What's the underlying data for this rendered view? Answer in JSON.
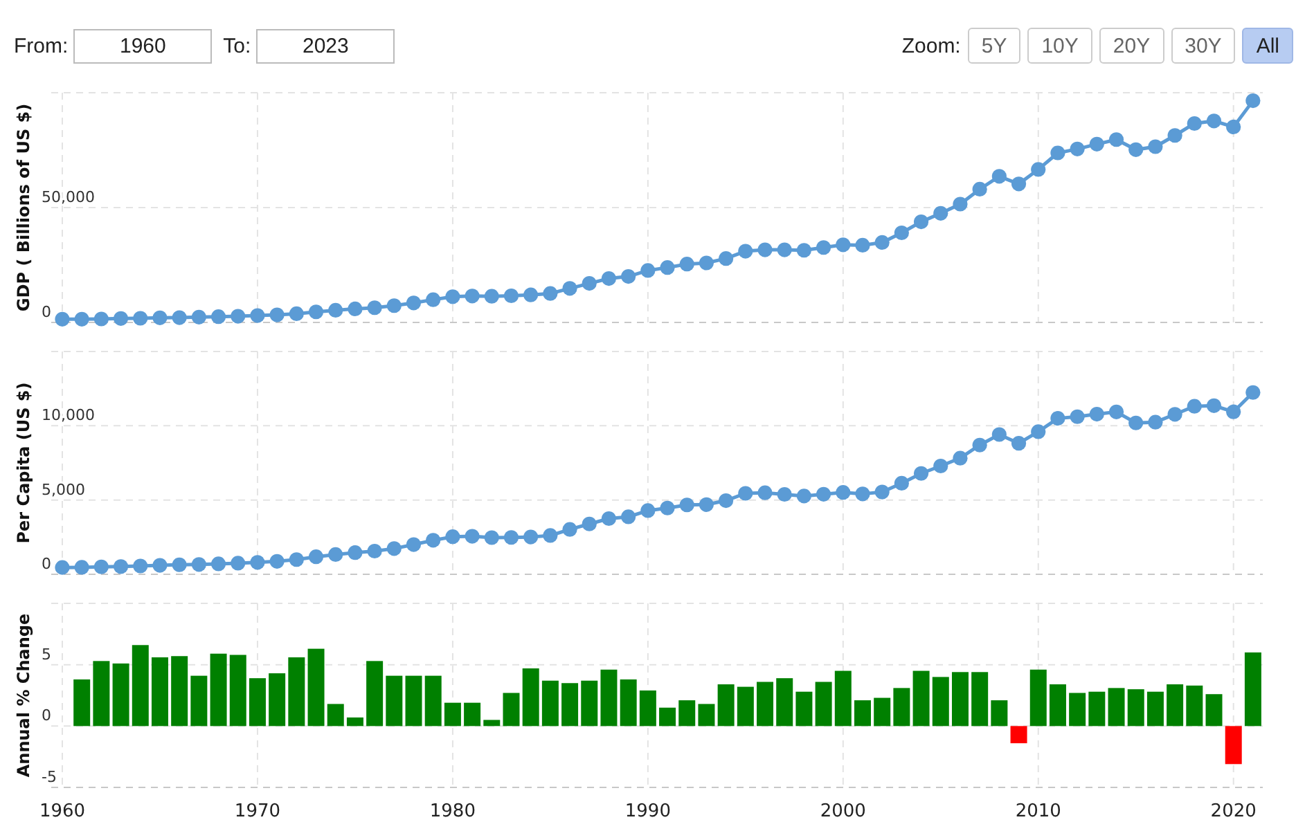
{
  "date_range": {
    "from_label": "From:",
    "from_value": "1960",
    "to_label": "To:",
    "to_value": "2023"
  },
  "zoom": {
    "label": "Zoom:",
    "buttons": [
      {
        "label": "5Y",
        "selected": false
      },
      {
        "label": "10Y",
        "selected": false
      },
      {
        "label": "20Y",
        "selected": false
      },
      {
        "label": "30Y",
        "selected": false
      },
      {
        "label": "All",
        "selected": true
      }
    ]
  },
  "charts": [
    {
      "chart_data": {
        "type": "line",
        "ylabel": "GDP ( Billions of US $)",
        "grid": true,
        "x": [
          1960,
          1961,
          1962,
          1963,
          1964,
          1965,
          1966,
          1967,
          1968,
          1969,
          1970,
          1971,
          1972,
          1973,
          1974,
          1975,
          1976,
          1977,
          1978,
          1979,
          1980,
          1981,
          1982,
          1983,
          1984,
          1985,
          1986,
          1987,
          1988,
          1989,
          1990,
          1991,
          1992,
          1993,
          1994,
          1995,
          1996,
          1997,
          1998,
          1999,
          2000,
          2001,
          2002,
          2003,
          2004,
          2005,
          2006,
          2007,
          2008,
          2009,
          2010,
          2011,
          2012,
          2013,
          2014,
          2015,
          2016,
          2017,
          2018,
          2019,
          2020,
          2021
        ],
        "xlim": [
          1960,
          2021.5
        ],
        "ylim": [
          0,
          100000
        ],
        "yticks": [
          {
            "value": 0,
            "label": "0"
          },
          {
            "value": 50000,
            "label": "50,000"
          }
        ],
        "series": [
          {
            "color": "#5b9bd5",
            "marker": "circle",
            "values": [
              1400,
              1400,
              1500,
              1700,
              1800,
              2000,
              2100,
              2300,
              2500,
              2700,
              3000,
              3300,
              3800,
              4600,
              5300,
              5900,
              6400,
              7300,
              8500,
              9900,
              11200,
              11500,
              11400,
              11600,
              12000,
              12600,
              14800,
              17000,
              19100,
              20000,
              22600,
              23900,
              25400,
              25900,
              27800,
              31000,
              31600,
              31600,
              31400,
              32600,
              33800,
              33600,
              34800,
              39000,
              43800,
              47500,
              51500,
              58000,
              63600,
              60300,
              66600,
              73800,
              75500,
              77600,
              79600,
              75200,
              76500,
              81400,
              86600,
              87700,
              85100,
              96500
            ]
          }
        ]
      }
    },
    {
      "chart_data": {
        "type": "line",
        "ylabel": "Per Capita (US $)",
        "grid": true,
        "x": [
          1960,
          1961,
          1962,
          1963,
          1964,
          1965,
          1966,
          1967,
          1968,
          1969,
          1970,
          1971,
          1972,
          1973,
          1974,
          1975,
          1976,
          1977,
          1978,
          1979,
          1980,
          1981,
          1982,
          1983,
          1984,
          1985,
          1986,
          1987,
          1988,
          1989,
          1990,
          1991,
          1992,
          1993,
          1994,
          1995,
          1996,
          1997,
          1998,
          1999,
          2000,
          2001,
          2002,
          2003,
          2004,
          2005,
          2006,
          2007,
          2008,
          2009,
          2010,
          2011,
          2012,
          2013,
          2014,
          2015,
          2016,
          2017,
          2018,
          2019,
          2020,
          2021
        ],
        "xlim": [
          1960,
          2021.5
        ],
        "ylim": [
          0,
          15000
        ],
        "yticks": [
          {
            "value": 0,
            "label": "0"
          },
          {
            "value": 5000,
            "label": "5,000"
          },
          {
            "value": 10000,
            "label": "10,000"
          }
        ],
        "series": [
          {
            "color": "#5b9bd5",
            "marker": "circle",
            "values": [
              460,
              470,
              500,
              520,
              560,
              600,
              640,
              660,
              700,
              750,
              800,
              870,
              990,
              1180,
              1330,
              1460,
              1560,
              1730,
              2000,
              2290,
              2530,
              2560,
              2470,
              2480,
              2510,
              2610,
              3020,
              3390,
              3750,
              3870,
              4290,
              4460,
              4670,
              4690,
              4960,
              5450,
              5490,
              5380,
              5270,
              5390,
              5510,
              5410,
              5540,
              6130,
              6790,
              7290,
              7820,
              8700,
              9410,
              8820,
              9600,
              10500,
              10610,
              10780,
              10930,
              10190,
              10240,
              10770,
              11310,
              11350,
              10940,
              12240
            ]
          }
        ]
      }
    },
    {
      "chart_data": {
        "type": "bar",
        "ylabel": "Annual % Change",
        "grid": true,
        "x": [
          1961,
          1962,
          1963,
          1964,
          1965,
          1966,
          1967,
          1968,
          1969,
          1970,
          1971,
          1972,
          1973,
          1974,
          1975,
          1976,
          1977,
          1978,
          1979,
          1980,
          1981,
          1982,
          1983,
          1984,
          1985,
          1986,
          1987,
          1988,
          1989,
          1990,
          1991,
          1992,
          1993,
          1994,
          1995,
          1996,
          1997,
          1998,
          1999,
          2000,
          2001,
          2002,
          2003,
          2004,
          2005,
          2006,
          2007,
          2008,
          2009,
          2010,
          2011,
          2012,
          2013,
          2014,
          2015,
          2016,
          2017,
          2018,
          2019,
          2020,
          2021
        ],
        "xlim": [
          1960,
          2021.5
        ],
        "ylim": [
          -5,
          10
        ],
        "xticks": [
          1960,
          1970,
          1980,
          1990,
          2000,
          2010,
          2020
        ],
        "yticks": [
          -5,
          0,
          5
        ],
        "series": [
          {
            "color": "#008000",
            "values": [
              3.8,
              5.3,
              5.1,
              6.6,
              5.6,
              5.7,
              4.1,
              5.9,
              5.8,
              3.9,
              4.3,
              5.6,
              6.3,
              1.8,
              0.7,
              5.3,
              4.1,
              4.1,
              4.1,
              1.9,
              1.9,
              0.5,
              2.7,
              4.7,
              3.7,
              3.5,
              3.7,
              4.6,
              3.8,
              2.9,
              1.5,
              2.1,
              1.8,
              3.4,
              3.2,
              3.6,
              3.9,
              2.8,
              3.6,
              4.5,
              2.1,
              2.3,
              3.1,
              4.5,
              4.0,
              4.4,
              4.4,
              2.1,
              null,
              4.6,
              3.4,
              2.7,
              2.8,
              3.1,
              3.0,
              2.8,
              3.4,
              3.3,
              2.6,
              null,
              6.0
            ]
          },
          {
            "color": "#ff0000",
            "values": [
              null,
              null,
              null,
              null,
              null,
              null,
              null,
              null,
              null,
              null,
              null,
              null,
              null,
              null,
              null,
              null,
              null,
              null,
              null,
              null,
              null,
              null,
              null,
              null,
              null,
              null,
              null,
              null,
              null,
              null,
              null,
              null,
              null,
              null,
              null,
              null,
              null,
              null,
              null,
              null,
              null,
              null,
              null,
              null,
              null,
              null,
              null,
              null,
              -1.4,
              null,
              null,
              null,
              null,
              null,
              null,
              null,
              null,
              null,
              null,
              -3.1,
              null
            ]
          }
        ]
      }
    }
  ]
}
